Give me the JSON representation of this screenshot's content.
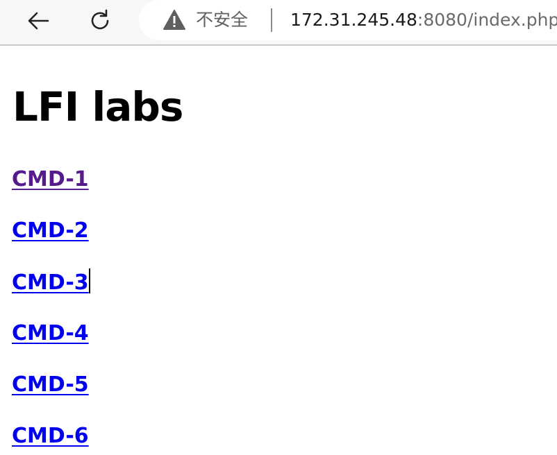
{
  "browser": {
    "back_icon": "back-arrow-icon",
    "reload_icon": "reload-icon",
    "security_icon": "warning-triangle-icon",
    "security_label": "不安全",
    "url_host": "172.31.245.48",
    "url_rest": ":8080/index.php"
  },
  "page": {
    "title": "LFI labs",
    "links": [
      {
        "label": "CMD-1",
        "visited": true
      },
      {
        "label": "CMD-2",
        "visited": false
      },
      {
        "label": "CMD-3",
        "visited": false
      },
      {
        "label": "CMD-4",
        "visited": false
      },
      {
        "label": "CMD-5",
        "visited": false
      },
      {
        "label": "CMD-6",
        "visited": false
      }
    ]
  },
  "colors": {
    "link": "#0000ee",
    "visited_link": "#551a8b",
    "toolbar_bg": "#f7f7f7"
  }
}
